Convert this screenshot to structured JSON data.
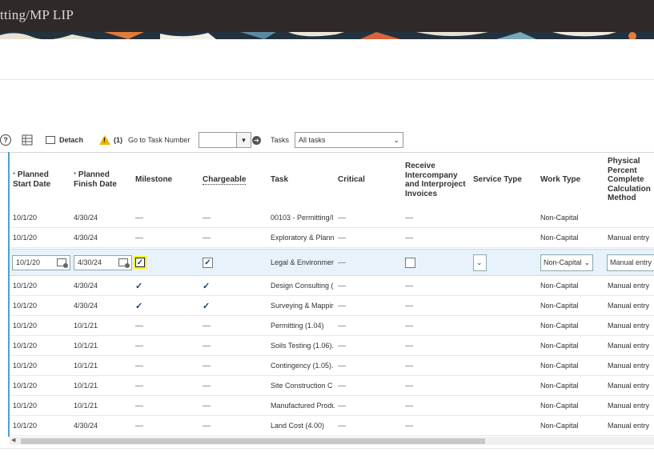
{
  "header": {
    "title": "tting/MP LIP"
  },
  "toolbar": {
    "detach_label": "Detach",
    "warning_count": "(1)",
    "goto_label": "Go to Task Number",
    "goto_value": "",
    "tasks_label": "Tasks",
    "tasks_value": "All tasks"
  },
  "columns": {
    "planned_start": "Planned Start Date",
    "planned_finish": "Planned Finish Date",
    "milestone": "Milestone",
    "chargeable": "Chargeable",
    "task": "Task",
    "critical": "Critical",
    "receive_ic": "Receive Intercompany and Interproject Invoices",
    "service_type": "Service Type",
    "work_type": "Work Type",
    "phys_pct": "Physical Percent Complete Calculation Method"
  },
  "rows": [
    {
      "start": "10/1/20",
      "finish": "4/30/24",
      "milestone": "—",
      "chargeable": "—",
      "task": "00103 - Permitting/I",
      "work_type": "Non-Capital",
      "method": ""
    },
    {
      "start": "10/1/20",
      "finish": "4/30/24",
      "milestone": "—",
      "chargeable": "—",
      "task": "Exploratory & Plann",
      "work_type": "Non-Capital",
      "method": "Manual entry"
    },
    {
      "start": "10/1/20",
      "finish": "4/30/24",
      "milestone": "checked",
      "chargeable": "checked",
      "task": "Legal & Environmer",
      "work_type": "Non-Capital",
      "method": "Manual entry",
      "selected": true
    },
    {
      "start": "10/1/20",
      "finish": "4/30/24",
      "milestone": "✓",
      "chargeable": "✓",
      "task": "Design Consulting (",
      "work_type": "Non-Capital",
      "method": "Manual entry"
    },
    {
      "start": "10/1/20",
      "finish": "4/30/24",
      "milestone": "✓",
      "chargeable": "✓",
      "task": "Surveying & Mappir",
      "work_type": "Non-Capital",
      "method": "Manual entry"
    },
    {
      "start": "10/1/20",
      "finish": "10/1/21",
      "milestone": "—",
      "chargeable": "—",
      "task": "Permitting (1.04)",
      "work_type": "Non-Capital",
      "method": "Manual entry"
    },
    {
      "start": "10/1/20",
      "finish": "10/1/21",
      "milestone": "—",
      "chargeable": "—",
      "task": "Soils Testing (1.06).",
      "work_type": "Non-Capital",
      "method": "Manual entry"
    },
    {
      "start": "10/1/20",
      "finish": "10/1/21",
      "milestone": "—",
      "chargeable": "—",
      "task": "Contingency (1.05).",
      "work_type": "Non-Capital",
      "method": "Manual entry"
    },
    {
      "start": "10/1/20",
      "finish": "10/1/21",
      "milestone": "—",
      "chargeable": "—",
      "task": "Site Construction C",
      "work_type": "Non-Capital",
      "method": "Manual entry"
    },
    {
      "start": "10/1/20",
      "finish": "10/1/21",
      "milestone": "—",
      "chargeable": "—",
      "task": "Manufactured Produ",
      "work_type": "Non-Capital",
      "method": "Manual entry"
    },
    {
      "start": "10/1/20",
      "finish": "4/30/24",
      "milestone": "—",
      "chargeable": "—",
      "task": "Land Cost (4.00)",
      "work_type": "Non-Capital",
      "method": "Manual entry"
    }
  ],
  "colors": {
    "accent": "#4d9fd6",
    "header_bg": "#2f2a28",
    "highlight": "#f6f21a",
    "selected_row": "#e8f2fb"
  }
}
